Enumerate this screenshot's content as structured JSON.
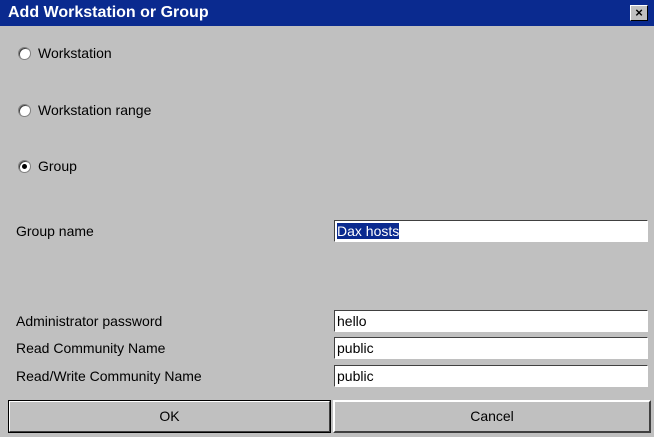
{
  "window": {
    "title": "Add Workstation or Group",
    "close_glyph": "×"
  },
  "options": [
    {
      "label": "Workstation",
      "checked": false
    },
    {
      "label": "Workstation range",
      "checked": false
    },
    {
      "label": "Group",
      "checked": true
    }
  ],
  "group_name": {
    "label": "Group name",
    "value": "Dax hosts"
  },
  "fields": {
    "admin_password": {
      "label": "Administrator password",
      "value": "hello"
    },
    "read_community": {
      "label": "Read Community Name",
      "value": "public"
    },
    "readwrite_community": {
      "label": "Read/Write Community Name",
      "value": "public"
    }
  },
  "buttons": {
    "ok": "OK",
    "cancel": "Cancel"
  },
  "colors": {
    "face": "#c0c0c0",
    "titlebar": "#0a2a8f",
    "selection": "#0a2a8f"
  }
}
